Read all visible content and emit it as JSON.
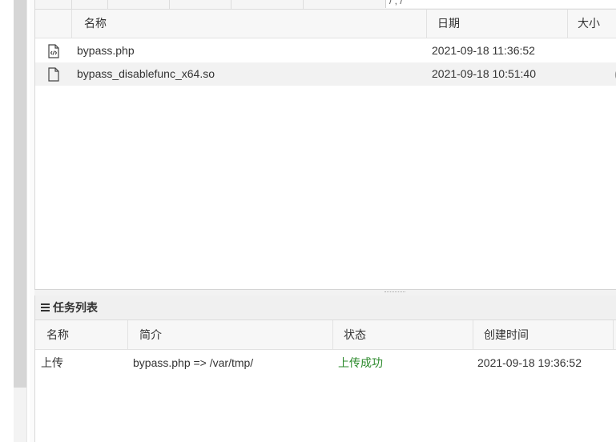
{
  "file_table": {
    "header": {
      "name": "名称",
      "date": "日期",
      "size": "大小"
    },
    "top_path_fragment": "/  ,  /",
    "rows": [
      {
        "icon": "php-code-file-icon",
        "name": "bypass.php",
        "date": "2021-09-18 11:36:52",
        "size": ""
      },
      {
        "icon": "file-icon",
        "name": "bypass_disablefunc_x64.so",
        "date": "2021-09-18 10:51:40",
        "size": ""
      }
    ],
    "clipped_size_mark": "("
  },
  "task_panel": {
    "title": "任务列表",
    "title_icon": "list-icon",
    "headers": {
      "name": "名称",
      "desc": "简介",
      "status": "状态",
      "created": "创建时间"
    },
    "rows": [
      {
        "name": "上传",
        "desc": "bypass.php => /var/tmp/",
        "status": "上传成功",
        "created": "2021-09-18 19:36:52"
      }
    ]
  },
  "colors": {
    "success": "#2c8a2c",
    "row_alt": "#f2f2f2",
    "header_bg": "#f7f7f7"
  }
}
